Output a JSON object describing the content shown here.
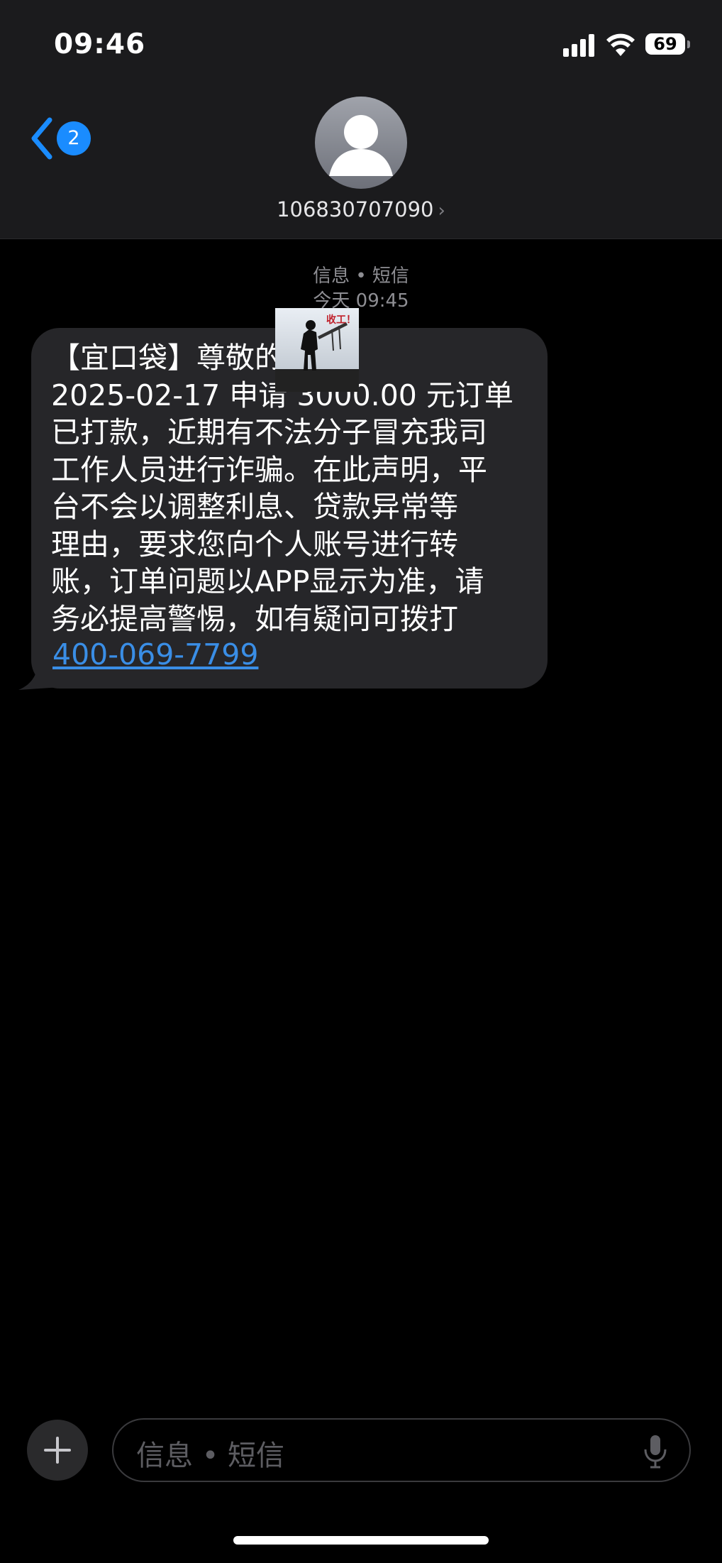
{
  "status_bar": {
    "time": "09:46",
    "battery": "69"
  },
  "header": {
    "back_count": "2",
    "contact": "106830707090",
    "chevron": "›"
  },
  "conversation": {
    "service": "信息 • 短信",
    "timestamp": "今天 09:45"
  },
  "message": {
    "text": "【宜口袋】尊敬的       您\n 2025-02-17 申请 3000.00 元订单\n已打款，近期有不法分子冒充我司\n工作人员进行诈骗。在此声明，平\n台不会以调整利息、贷款异常等\n理由，要求您向个人账号进行转\n账，订单问题以APP显示为准，请\n务必提高警惕，如有疑问可拨打",
    "phone_link": "400-069-7799",
    "sticker_text": "收工！"
  },
  "composer": {
    "placeholder": "信息 • 短信"
  },
  "colors": {
    "accent": "#1a8cff",
    "link": "#3a8ee6",
    "bubble": "#262629",
    "header": "#1b1b1d"
  }
}
